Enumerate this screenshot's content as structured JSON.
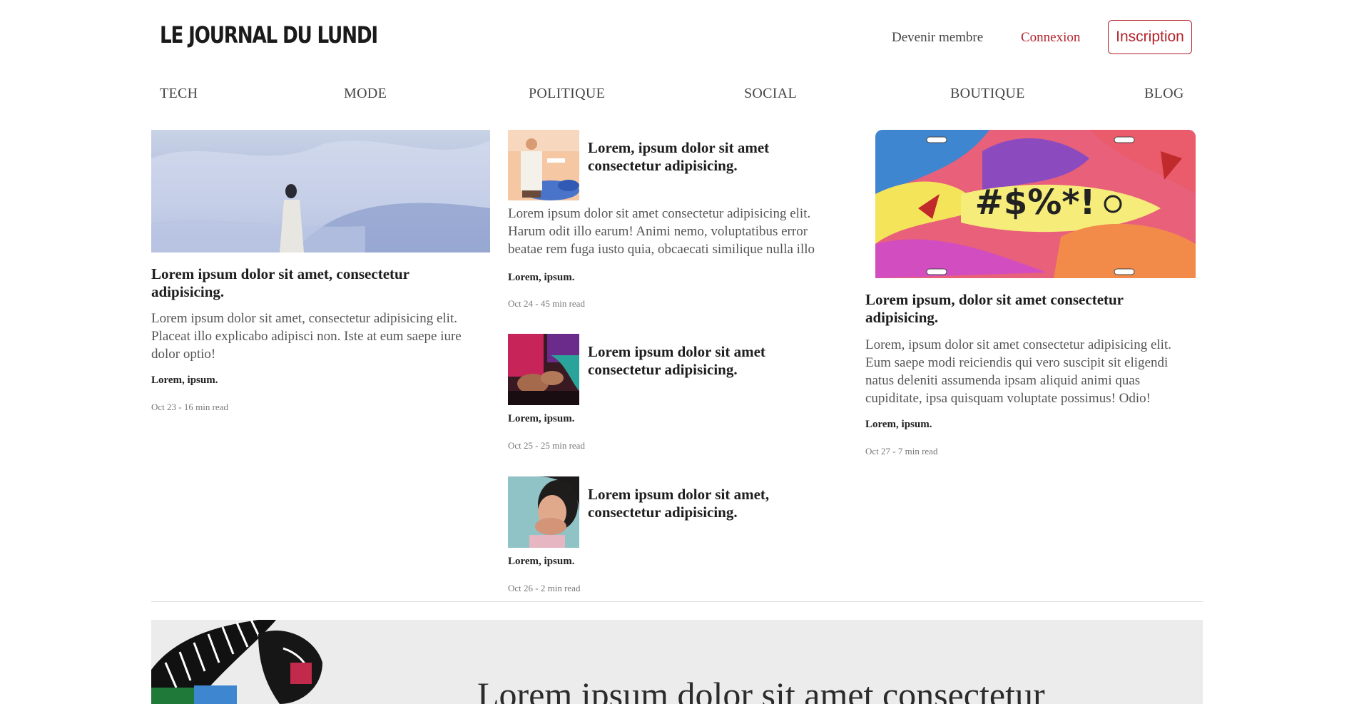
{
  "header": {
    "logo": "LE JOURNAL DU LUNDI",
    "become_member": "Devenir membre",
    "login": "Connexion",
    "signup": "Inscription"
  },
  "nav": [
    "TECH",
    "MODE",
    "POLITIQUE",
    "SOCIAL",
    "BOUTIQUE",
    "BLOG"
  ],
  "colors": {
    "accent": "#b4232c",
    "promo_bg": "#ececec"
  },
  "left_article": {
    "title": "Lorem ipsum dolor sit amet, consectetur adipisicing.",
    "body": "Lorem ipsum dolor sit amet, consectetur adipisicing elit. Placeat illo explicabo adipisci non. Iste at eum saepe iure dolor optio!",
    "author": "Lorem, ipsum.",
    "meta": "Oct 23 - 16 min read"
  },
  "middle_articles": [
    {
      "title": "Lorem, ipsum dolor sit amet consectetur adipisicing.",
      "body": "Lorem ipsum dolor sit amet consectetur adipisicing elit. Harum odit illo earum! Animi nemo, voluptatibus error beatae rem fuga iusto quia, obcaecati similique nulla illo",
      "author": "Lorem, ipsum.",
      "meta": "Oct 24 - 45 min read"
    },
    {
      "title": "Lorem ipsum dolor sit amet consectetur adipisicing.",
      "author": "Lorem, ipsum.",
      "meta": "Oct 25 - 25 min read"
    },
    {
      "title": "Lorem ipsum dolor sit amet, consectetur adipisicing.",
      "author": "Lorem, ipsum.",
      "meta": "Oct 26 - 2 min read"
    }
  ],
  "right_article": {
    "plate_text": "#$%*!",
    "title": "Lorem ipsum, dolor sit amet consectetur adipisicing.",
    "body": "Lorem, ipsum dolor sit amet consectetur adipisicing elit. Eum saepe modi reiciendis qui vero suscipit sit eligendi natus deleniti assumenda ipsam aliquid animi quas cupiditate, ipsa quisquam voluptate possimus! Odio!",
    "author": "Lorem, ipsum.",
    "meta": "Oct 27 - 7 min read"
  },
  "promo": {
    "title": "Lorem ipsum dolor sit amet consectetur"
  }
}
